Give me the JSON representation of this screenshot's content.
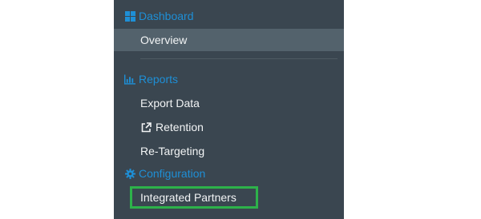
{
  "sidebar": {
    "sections": {
      "dashboard": {
        "label": "Dashboard",
        "icon": "dashboard-grid-icon"
      },
      "reports": {
        "label": "Reports",
        "icon": "bar-chart-icon"
      },
      "configuration": {
        "label": "Configuration",
        "icon": "gear-icon"
      }
    },
    "items": {
      "overview": {
        "label": "Overview",
        "active": true
      },
      "export_data": {
        "label": "Export Data"
      },
      "retention": {
        "label": "Retention",
        "icon": "external-link-icon"
      },
      "retargeting": {
        "label": "Re-Targeting"
      },
      "integrated_partners": {
        "label": "Integrated Partners",
        "highlighted": true
      }
    }
  },
  "colors": {
    "sidebar_bg": "#3a4650",
    "active_item_bg": "#53626c",
    "section_text": "#1e8fd6",
    "item_text": "#f2f4f5",
    "highlight_border": "#2db24a",
    "page_bg": "#ffffff"
  }
}
